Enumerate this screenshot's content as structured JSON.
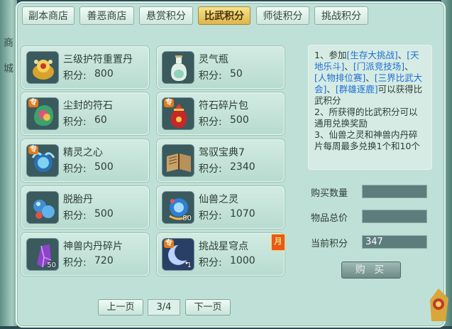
{
  "side": {
    "left_chars": [
      "商",
      "城"
    ]
  },
  "tabs": [
    {
      "label": "副本商店",
      "active": false
    },
    {
      "label": "善恶商店",
      "active": false
    },
    {
      "label": "悬赏积分",
      "active": false
    },
    {
      "label": "比武积分",
      "active": true
    },
    {
      "label": "师徒积分",
      "active": false
    },
    {
      "label": "挑战积分",
      "active": false
    }
  ],
  "price_label": "积分:",
  "badge_text": "专",
  "items": [
    {
      "name": "三级护符重置丹",
      "price": "800",
      "icon": "golden-amulet-icon",
      "badge": false,
      "qty": ""
    },
    {
      "name": "灵气瓶",
      "price": "50",
      "icon": "spirit-bottle-icon",
      "badge": false,
      "qty": ""
    },
    {
      "name": "尘封的符石",
      "price": "60",
      "icon": "rune-stone-icon",
      "badge": true,
      "qty": ""
    },
    {
      "name": "符石碎片包",
      "price": "500",
      "icon": "red-pouch-icon",
      "badge": true,
      "qty": ""
    },
    {
      "name": "精灵之心",
      "price": "500",
      "icon": "spirit-heart-icon",
      "badge": true,
      "qty": ""
    },
    {
      "name": "驾驭宝典7",
      "price": "2340",
      "icon": "open-book-icon",
      "badge": false,
      "qty": ""
    },
    {
      "name": "脱胎丹",
      "price": "500",
      "icon": "blue-orbs-icon",
      "badge": false,
      "qty": ""
    },
    {
      "name": "仙兽之灵",
      "price": "1070",
      "icon": "beast-spirit-orb-icon",
      "badge": false,
      "qty": "80"
    },
    {
      "name": "神兽内丹碎片",
      "price": "720",
      "icon": "purple-crystal-icon",
      "badge": false,
      "qty": "50"
    },
    {
      "name": "挑战星穹点",
      "price": "1000",
      "icon": "crescent-moon-icon",
      "badge": true,
      "qty": "1",
      "month_tag": "月"
    }
  ],
  "description": {
    "line1_a": "1、参加",
    "line1_b": "[生存大挑战]",
    "line1_c": "、",
    "line1_d": "[天地乐斗]",
    "line1_e": "、",
    "line1_f": "[门派竞技场]",
    "line1_g": "、",
    "line1_h": "[人物排位赛]",
    "line1_i": "、",
    "line1_j": "[三界比武大会]",
    "line1_k": "、",
    "line1_l": "[群雄逐鹿]",
    "line1_m": "可以获得比武积分",
    "line2": "2、所获得的比武积分可以通用兑换奖励",
    "line3": "3、仙兽之灵和神兽内丹碎片每周最多兑换1个和10个"
  },
  "form": {
    "quantity_label": "购买数量",
    "quantity_value": "",
    "total_label": "物品总价",
    "total_value": "",
    "points_label": "当前积分",
    "points_value": "347",
    "buy_label": "购 买"
  },
  "pagination": {
    "prev_label": "上一页",
    "page_text": "3/4",
    "next_label": "下一页"
  },
  "colors": {
    "accent": "#e2b94f",
    "highlight_text": "#1f6fd2",
    "panel": "#bfe0d6"
  }
}
